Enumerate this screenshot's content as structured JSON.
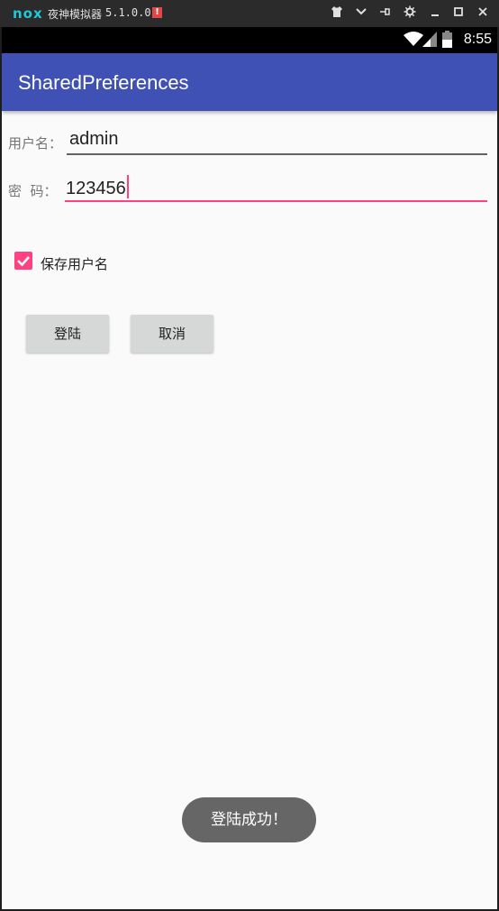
{
  "emulator": {
    "logo": "nox",
    "title": "夜神模拟器",
    "version": "5.1.0.0",
    "badge": "!",
    "controls": [
      "shirt-icon",
      "chevron-down-icon",
      "pin-icon",
      "gear-icon",
      "minimize-icon",
      "maximize-icon",
      "close-icon"
    ]
  },
  "status_bar": {
    "time": "8:55"
  },
  "app_bar": {
    "title": "SharedPreferences"
  },
  "form": {
    "username_label": "用户名：",
    "username_value": "admin",
    "password_label": "密  码：",
    "password_value": "123456",
    "remember_label": "保存用户名",
    "remember_checked": true
  },
  "buttons": {
    "login": "登陆",
    "cancel": "取消"
  },
  "toast": {
    "message": "登陆成功！"
  },
  "colors": {
    "primary": "#3f51b5",
    "accent": "#ff4081",
    "button": "#d6d7d7",
    "toast": "#666666"
  }
}
